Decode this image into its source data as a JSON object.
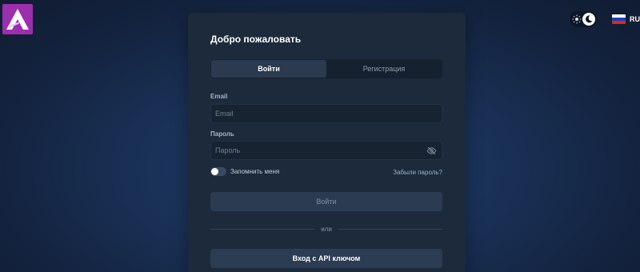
{
  "brand": {
    "logo_icon": "brand-logo-a",
    "logo_color": "#9b2fae"
  },
  "header": {
    "theme_toggle": {
      "icons": [
        "sun-icon",
        "moon-icon"
      ],
      "state": "dark"
    },
    "language": {
      "flag_icon": "russia-flag-icon",
      "code": "RU"
    }
  },
  "login_card": {
    "title": "Добро пожаловать",
    "tabs": [
      {
        "label": "Войти",
        "active": true
      },
      {
        "label": "Регистрация",
        "active": false
      }
    ],
    "email": {
      "label": "Email",
      "placeholder": "Email",
      "value": ""
    },
    "password": {
      "label": "Пароль",
      "placeholder": "Пароль",
      "value": "",
      "visibility_icon": "eye-off-icon"
    },
    "remember_me": {
      "label": "Запомнить меня",
      "checked": false
    },
    "forgot_password": "Забыли пароль?",
    "submit_label": "Войти",
    "divider_text": "или",
    "api_key_label": "Вход с API ключом"
  },
  "colors": {
    "background": "#13223d",
    "card": "#1c2a3c",
    "active_tab": "#2b3a4f",
    "input_bg": "#172331"
  }
}
